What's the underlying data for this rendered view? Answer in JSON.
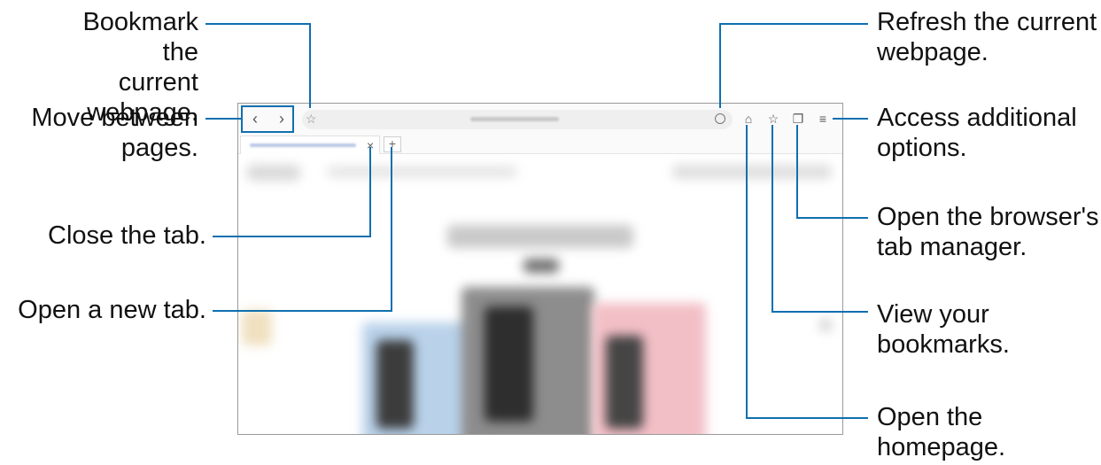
{
  "callouts": {
    "bookmark_current": "Bookmark the\ncurrent webpage.",
    "move_between": "Move between\npages.",
    "close_tab": "Close the tab.",
    "new_tab": "Open a new tab.",
    "refresh": "Refresh the current\nwebpage.",
    "additional_options": "Access additional\noptions.",
    "tab_manager": "Open the browser's\ntab manager.",
    "view_bookmarks": "View your\nbookmarks.",
    "homepage": "Open the\nhomepage."
  },
  "browser": {
    "back_icon": "‹",
    "forward_icon": "›",
    "tab_close_icon": "×",
    "new_tab_icon": "+",
    "home_icon": "⌂",
    "bookmarks_icon": "☆",
    "tabs_icon": "❐",
    "menu_icon": "≡",
    "star_icon": "☆"
  },
  "colors": {
    "leader_line": "#0f6fb0",
    "frame": "#9a9a9a"
  },
  "icons": [
    "back-icon",
    "forward-icon",
    "star-icon",
    "refresh-icon",
    "home-icon",
    "bookmarks-icon",
    "tab-manager-icon",
    "menu-icon",
    "close-icon",
    "plus-icon"
  ]
}
